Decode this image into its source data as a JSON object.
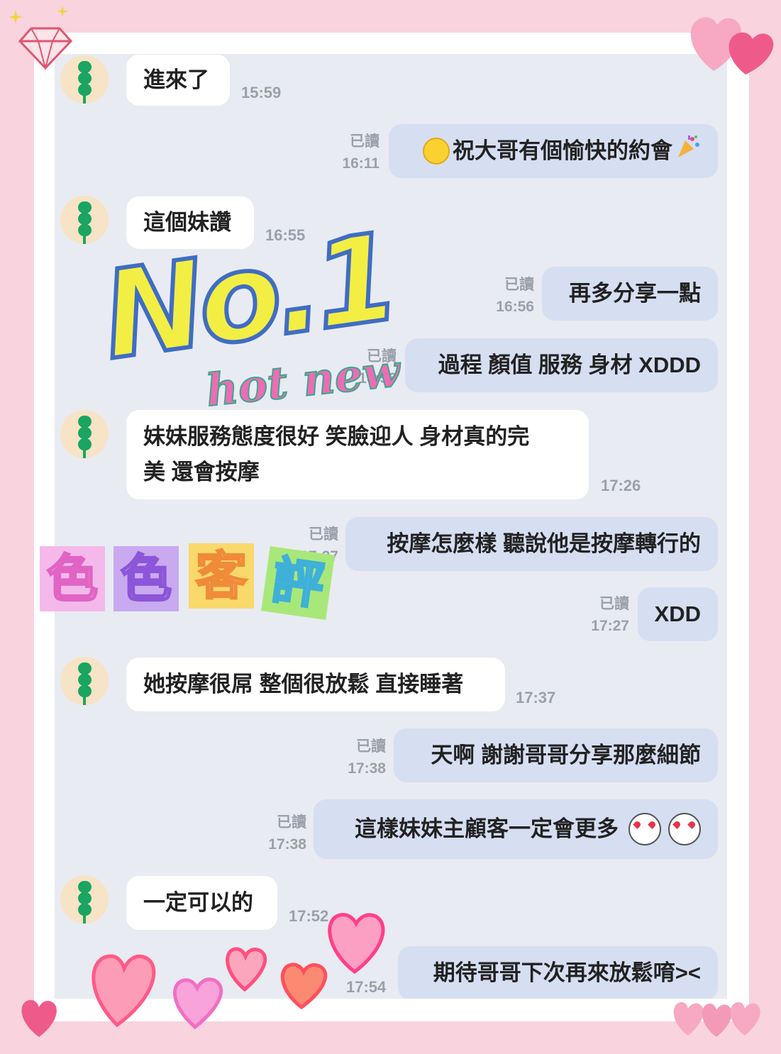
{
  "chat": {
    "read_label": "已讀",
    "messages": [
      {
        "side": "in",
        "text": "進來了",
        "time": "15:59"
      },
      {
        "side": "out",
        "text": "祝大哥有個愉快的約會",
        "time": "16:11",
        "read": "已讀"
      },
      {
        "side": "in",
        "text": "這個妹讚",
        "time": "16:55"
      },
      {
        "side": "out",
        "text": "再多分享一點",
        "time": "16:56",
        "read": "已讀"
      },
      {
        "side": "out",
        "text": "過程 顏值 服務 身材 XDDD",
        "time": "16:56",
        "read": "已讀"
      },
      {
        "side": "in",
        "text": "妹妹服務態度很好 笑臉迎人 身材真的完",
        "text2": "美 還會按摩",
        "time": "17:26"
      },
      {
        "side": "out",
        "text": "按摩怎麼樣 聽說他是按摩轉行的",
        "time": "17:27",
        "read": "已讀"
      },
      {
        "side": "out",
        "text": "XDD",
        "time": "17:27",
        "read": "已讀"
      },
      {
        "side": "in",
        "text": "她按摩很屌 整個很放鬆 直接睡著",
        "time": "17:37"
      },
      {
        "side": "out",
        "text": "天啊 謝謝哥哥分享那麼細節",
        "time": "17:38",
        "read": "已讀"
      },
      {
        "side": "out",
        "text": "這樣妹妹主顧客一定會更多",
        "time": "17:38",
        "read": "已讀"
      },
      {
        "side": "in",
        "text": "一定可以的",
        "time": "17:52"
      },
      {
        "side": "out",
        "text": "期待哥哥下次再來放鬆唷><",
        "time": "17:54"
      }
    ]
  },
  "stickers": {
    "no1": "No.1",
    "hot_new": "hot new",
    "review_chars": [
      "色",
      "色",
      "客",
      "評"
    ]
  },
  "colors": {
    "accent_green": "#1aa561",
    "outgoing_bubble": "#d6def2",
    "chat_background": "#e9ebf2"
  },
  "icons": [
    "grin-emoji",
    "party-popper-emoji",
    "heart-eyes-emoji",
    "diamond-icon",
    "heart-icon",
    "sparkle-icon"
  ]
}
